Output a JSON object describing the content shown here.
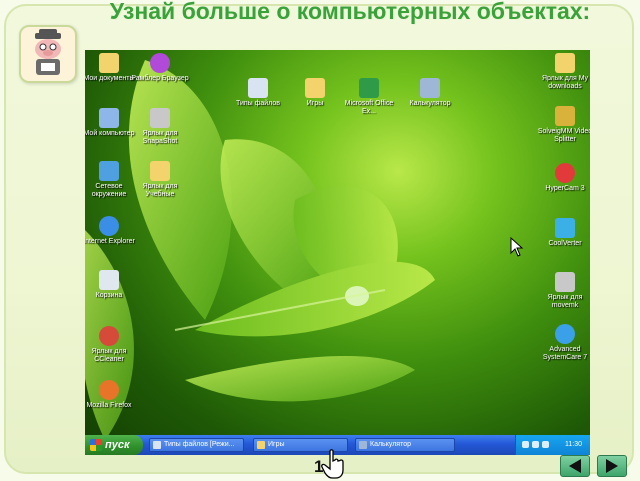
{
  "slide": {
    "title": "Узнай больше о компьютерных объектах:",
    "page_number": "1"
  },
  "desktop": {
    "icons_left": [
      {
        "label": "Мои документы",
        "color": "#f3d36b"
      },
      {
        "label": "Рамблер Браузер",
        "color": "#b14ad8"
      },
      {
        "label": "Мой компьютер",
        "color": "#8fb6e8"
      },
      {
        "label": "Ярлык для SnapaShot",
        "color": "#c8c8c8"
      },
      {
        "label": "Сетевое окружение",
        "color": "#4fa0e0"
      },
      {
        "label": "Ярлык для Учебные",
        "color": "#f3d36b"
      },
      {
        "label": "Internet Explorer",
        "color": "#3a8ee6"
      },
      {
        "label": "Корзина",
        "color": "#dfe8ef"
      },
      {
        "label": "Ярлык для CCleaner",
        "color": "#d64a3a"
      },
      {
        "label": "Mozilla Firefox",
        "color": "#e8742a"
      }
    ],
    "icons_top": [
      {
        "label": "Типы файлов",
        "color": "#d9e4f2"
      },
      {
        "label": "Игры",
        "color": "#f3d36b"
      },
      {
        "label": "Microsoft Office Ex...",
        "color": "#2f9a48"
      },
      {
        "label": "Калькулятор",
        "color": "#9fb7d6"
      }
    ],
    "icons_right": [
      {
        "label": "Ярлык для My downloads",
        "color": "#f3d36b"
      },
      {
        "label": "SolveigMM Video Splitter",
        "color": "#d8b23a"
      },
      {
        "label": "HyperCam 3",
        "color": "#e23a3a"
      },
      {
        "label": "CoolVerter",
        "color": "#3ab0e6"
      },
      {
        "label": "Ярлык для movemk",
        "color": "#c8c8c8"
      },
      {
        "label": "Advanced SystemCare 7",
        "color": "#3aa0e8"
      }
    ]
  },
  "taskbar": {
    "start_label": "пуск",
    "tasks": [
      {
        "label": "Типы файлов [Режи...",
        "color": "#d9e4f2"
      },
      {
        "label": "Игры",
        "color": "#f3d36b"
      },
      {
        "label": "Калькулятор",
        "color": "#9fb7d6"
      }
    ],
    "clock": "11:30"
  }
}
